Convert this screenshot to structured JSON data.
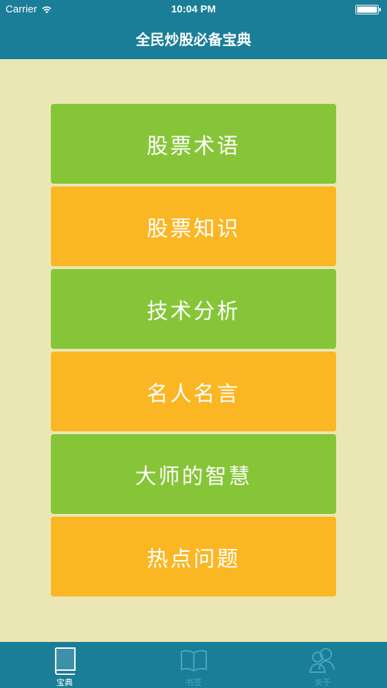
{
  "status_bar": {
    "carrier": "Carrier",
    "time": "10:04 PM"
  },
  "nav": {
    "title": "全民炒股必备宝典"
  },
  "menu": {
    "items": [
      {
        "label": "股票术语",
        "color": "#86c538"
      },
      {
        "label": "股票知识",
        "color": "#fbb624"
      },
      {
        "label": "技术分析",
        "color": "#86c538"
      },
      {
        "label": "名人名言",
        "color": "#fbb624"
      },
      {
        "label": "大师的智慧",
        "color": "#86c538"
      },
      {
        "label": "热点问题",
        "color": "#fbb624"
      }
    ]
  },
  "tabs": [
    {
      "label": "宝典",
      "icon": "book-icon",
      "active": true
    },
    {
      "label": "书签",
      "icon": "open-book-icon",
      "active": false
    },
    {
      "label": "关于",
      "icon": "people-icon",
      "active": false
    }
  ],
  "colors": {
    "bar": "#1b7e98",
    "background": "#ebe7b5",
    "green": "#86c538",
    "orange": "#fbb624"
  }
}
